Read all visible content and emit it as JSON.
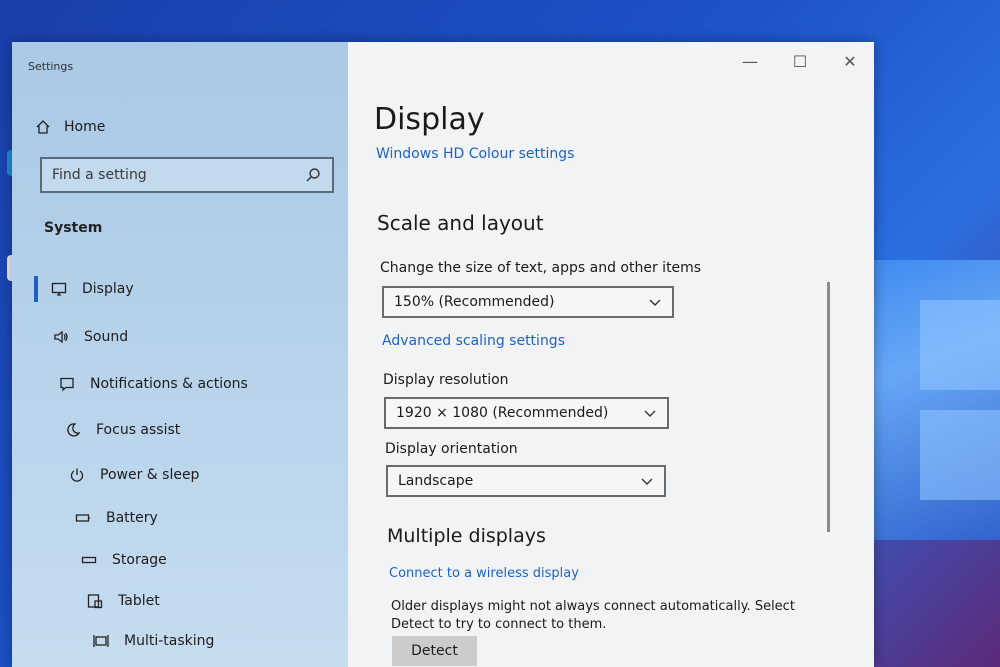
{
  "window": {
    "title": "Settings",
    "controls": {
      "minimize": "—",
      "maximize": "☐",
      "close": "✕"
    }
  },
  "sidebar": {
    "home_label": "Home",
    "search_placeholder": "Find a setting",
    "section": "System",
    "items": [
      {
        "label": "Display",
        "icon": "monitor-icon",
        "active": true
      },
      {
        "label": "Sound",
        "icon": "speaker-icon"
      },
      {
        "label": "Notifications & actions",
        "icon": "notification-icon"
      },
      {
        "label": "Focus assist",
        "icon": "moon-icon"
      },
      {
        "label": "Power & sleep",
        "icon": "power-icon"
      },
      {
        "label": "Battery",
        "icon": "battery-icon"
      },
      {
        "label": "Storage",
        "icon": "storage-icon"
      },
      {
        "label": "Tablet",
        "icon": "tablet-icon"
      },
      {
        "label": "Multi-tasking",
        "icon": "multitasking-icon"
      }
    ]
  },
  "main": {
    "title": "Display",
    "hd_colour_link": "Windows HD Colour settings",
    "scale_heading": "Scale and layout",
    "scale_label": "Change the size of text, apps and other items",
    "scale_value": "150% (Recommended)",
    "advanced_scaling_link": "Advanced scaling settings",
    "resolution_label": "Display resolution",
    "resolution_value": "1920 × 1080 (Recommended)",
    "orientation_label": "Display orientation",
    "orientation_value": "Landscape",
    "multiple_heading": "Multiple displays",
    "wireless_link": "Connect to a wireless display",
    "detect_note": "Older displays might not always connect automatically. Select Detect to try to connect to them.",
    "detect_button": "Detect"
  },
  "colors": {
    "accent": "#1e62c6",
    "sidebar_bg": "#b7d2ea",
    "main_bg": "#f2f3f4",
    "desktop_bg": "#1d52c9"
  }
}
